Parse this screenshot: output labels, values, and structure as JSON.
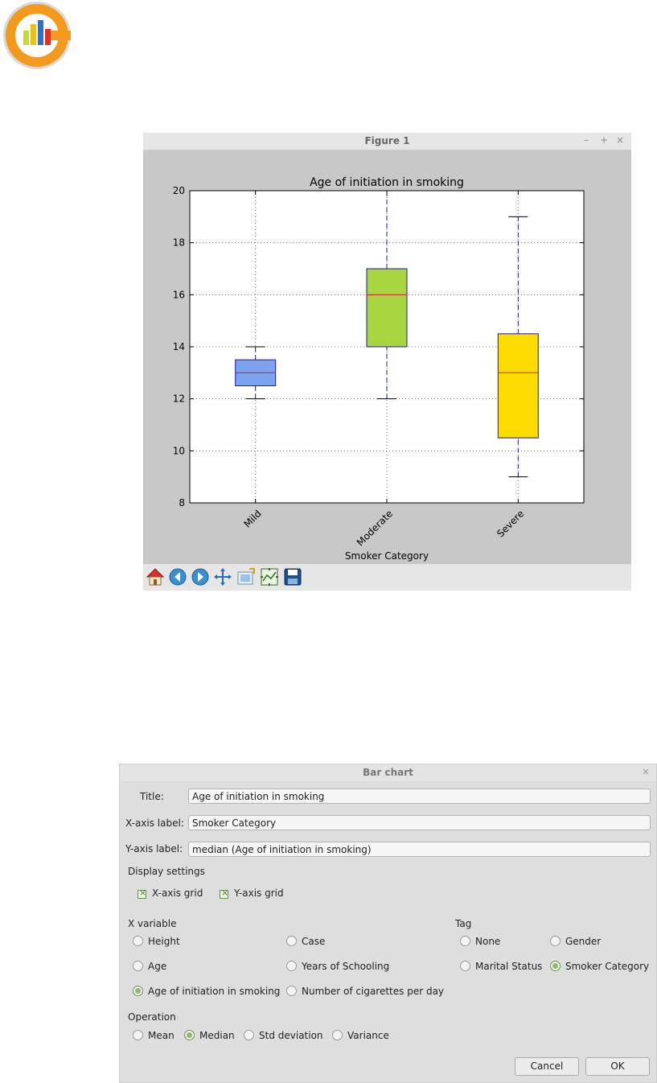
{
  "figure_window": {
    "title": "Figure 1",
    "controls": [
      "–",
      "+",
      "×"
    ]
  },
  "chart_data": {
    "type": "box",
    "title": "Age of initiation in smoking",
    "xlabel": "Smoker Category",
    "ylabel": "",
    "ylim": [
      8,
      20
    ],
    "yticks": [
      8,
      10,
      12,
      14,
      16,
      18,
      20
    ],
    "grid": true,
    "categories": [
      "Mild",
      "Moderate",
      "Severe"
    ],
    "boxes": [
      {
        "category": "Mild",
        "whisker_low": 12,
        "q1": 12.5,
        "median": 13,
        "q3": 13.5,
        "whisker_high": 14,
        "color": "#7ba3f0"
      },
      {
        "category": "Moderate",
        "whisker_low": 12,
        "q1": 14,
        "median": 16,
        "q3": 17,
        "whisker_high": 20,
        "color": "#a8d63e"
      },
      {
        "category": "Severe",
        "whisker_low": 9,
        "q1": 10.5,
        "median": 13,
        "q3": 14.5,
        "whisker_high": 19,
        "color": "#ffdc00"
      }
    ],
    "median_color": "#e0203a",
    "box_edge_color": "#1a1aa8"
  },
  "toolbar": {
    "icons": [
      "home-icon",
      "back-arrow-icon",
      "forward-arrow-icon",
      "pan-icon",
      "zoom-icon",
      "configure-subplots-icon",
      "save-icon"
    ]
  },
  "dialog": {
    "title": "Bar chart",
    "close": "×",
    "title_label": "Title:",
    "title_value": "Age of initiation in smoking",
    "xaxis_label": "X-axis label:",
    "xaxis_value": "Smoker Category",
    "yaxis_label": "Y-axis label:",
    "yaxis_value": "median (Age of initiation in smoking)",
    "display_settings": "Display settings",
    "xgrid": "X-axis grid",
    "ygrid": "Y-axis grid",
    "x_variable": "X variable",
    "xvars": [
      "Height",
      "Case",
      "Age",
      "Years of Schooling",
      "Age of initiation in smoking",
      "Number of cigarettes per day"
    ],
    "tag": "Tag",
    "tags": [
      "None",
      "Gender",
      "Marital Status",
      "Smoker Category"
    ],
    "operation": "Operation",
    "operations": [
      "Mean",
      "Median",
      "Std deviation",
      "Variance"
    ],
    "cancel": "Cancel",
    "ok": "OK"
  }
}
